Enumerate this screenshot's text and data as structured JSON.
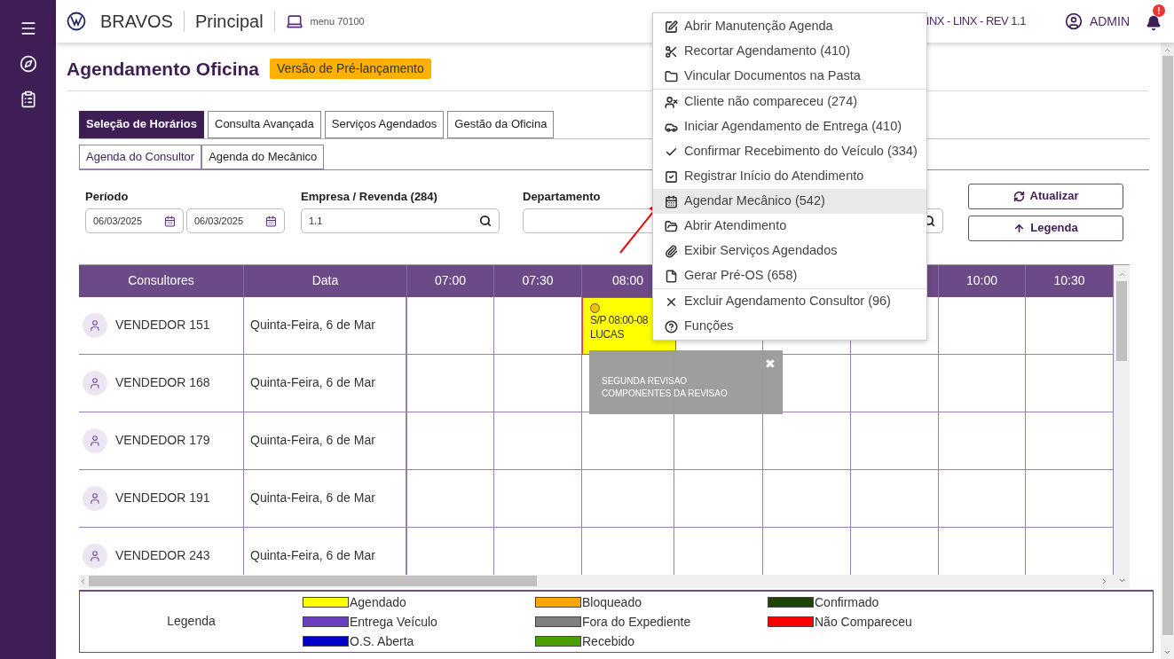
{
  "header": {
    "brand": "BRAVOS",
    "section": "Principal",
    "menu_code": "menu 70100",
    "system": "INX - LINX - REV 1.1",
    "user": "ADMIN",
    "alert": "!"
  },
  "page": {
    "title": "Agendamento Oficina",
    "badge": "Versão de Pré-lançamento"
  },
  "tabs": [
    {
      "label": "Seleção de Horários",
      "selected": true
    },
    {
      "label": "Consulta Avançada",
      "selected": false
    },
    {
      "label": "Serviços Agendados",
      "selected": false
    },
    {
      "label": "Gestão da Oficina",
      "selected": false
    }
  ],
  "subtabs": [
    {
      "label": "Agenda do Consultor",
      "selected": true
    },
    {
      "label": "Agenda do Mecânico",
      "selected": false
    }
  ],
  "filters": {
    "periodo": {
      "label": "Período",
      "from": "06/03/2025",
      "to": "06/03/2025"
    },
    "empresa": {
      "label": "Empresa / Revenda (284)",
      "value": "1.1"
    },
    "departamento": {
      "label": "Departamento"
    }
  },
  "buttons": [
    {
      "label": "Atualizar",
      "kind": "refresh"
    },
    {
      "label": "Legenda",
      "kind": "up"
    }
  ],
  "grid": {
    "columns": [
      "Consultores",
      "Data"
    ],
    "times_before_menu": [
      "07:00",
      "07:30",
      "08:00"
    ],
    "times_after_menu": [
      "10:00",
      "10:30"
    ],
    "rows": [
      {
        "consultor": "VENDEDOR 151",
        "data": "Quinta-Feira, 6 de Mar"
      },
      {
        "consultor": "VENDEDOR 168",
        "data": "Quinta-Feira, 6 de Mar"
      },
      {
        "consultor": "VENDEDOR 179",
        "data": "Quinta-Feira, 6 de Mar"
      },
      {
        "consultor": "VENDEDOR 191",
        "data": "Quinta-Feira, 6 de Mar"
      },
      {
        "consultor": "VENDEDOR 243",
        "data": "Quinta-Feira, 6 de Mar"
      }
    ],
    "appointment": {
      "line1": "S/P 08:00-08",
      "line2": "LUCAS",
      "color": "#ffff00"
    },
    "tooltip": {
      "lines": [
        "SEGUNDA REVISAO",
        "COMPONENTES DA REVISAO"
      ],
      "close": "✖"
    }
  },
  "legend": {
    "label": "Legenda",
    "items": [
      {
        "label": "Agendado",
        "color": "#ffff00"
      },
      {
        "label": "Bloqueado",
        "color": "#ffa500"
      },
      {
        "label": "Confirmado",
        "color": "#1e4500"
      },
      {
        "label": "Entrega Veículo",
        "color": "#6a3fc0"
      },
      {
        "label": "Fora do Expediente",
        "color": "#808080"
      },
      {
        "label": "Não Compareceu",
        "color": "#ff0000"
      },
      {
        "label": "O.S. Aberta",
        "color": "#0000c8"
      },
      {
        "label": "Recebido",
        "color": "#4aa000"
      }
    ]
  },
  "context_menu": {
    "groups": [
      [
        {
          "label": "Abrir Manutenção Agenda",
          "selected": false
        },
        {
          "label": "Recortar Agendamento (410)",
          "selected": false
        },
        {
          "label": "Vincular Documentos na Pasta",
          "selected": false
        }
      ],
      [
        {
          "label": "Cliente não compareceu (274)",
          "selected": false
        },
        {
          "label": "Iniciar Agendamento de Entrega (410)",
          "selected": false
        },
        {
          "label": "Confirmar Recebimento do Veículo (334)",
          "selected": false
        },
        {
          "label": "Registrar Início do Atendimento",
          "selected": false
        },
        {
          "label": "Agendar Mecânico (542)",
          "selected": true
        },
        {
          "label": "Abrir Atendimento",
          "selected": false
        },
        {
          "label": "Exibir Serviços Agendados",
          "selected": false
        },
        {
          "label": "Gerar Pré-OS (658)",
          "selected": false
        }
      ],
      [
        {
          "label": "Excluir Agendamento Consultor (96)",
          "selected": false
        },
        {
          "label": "Funções",
          "selected": false
        }
      ]
    ]
  }
}
